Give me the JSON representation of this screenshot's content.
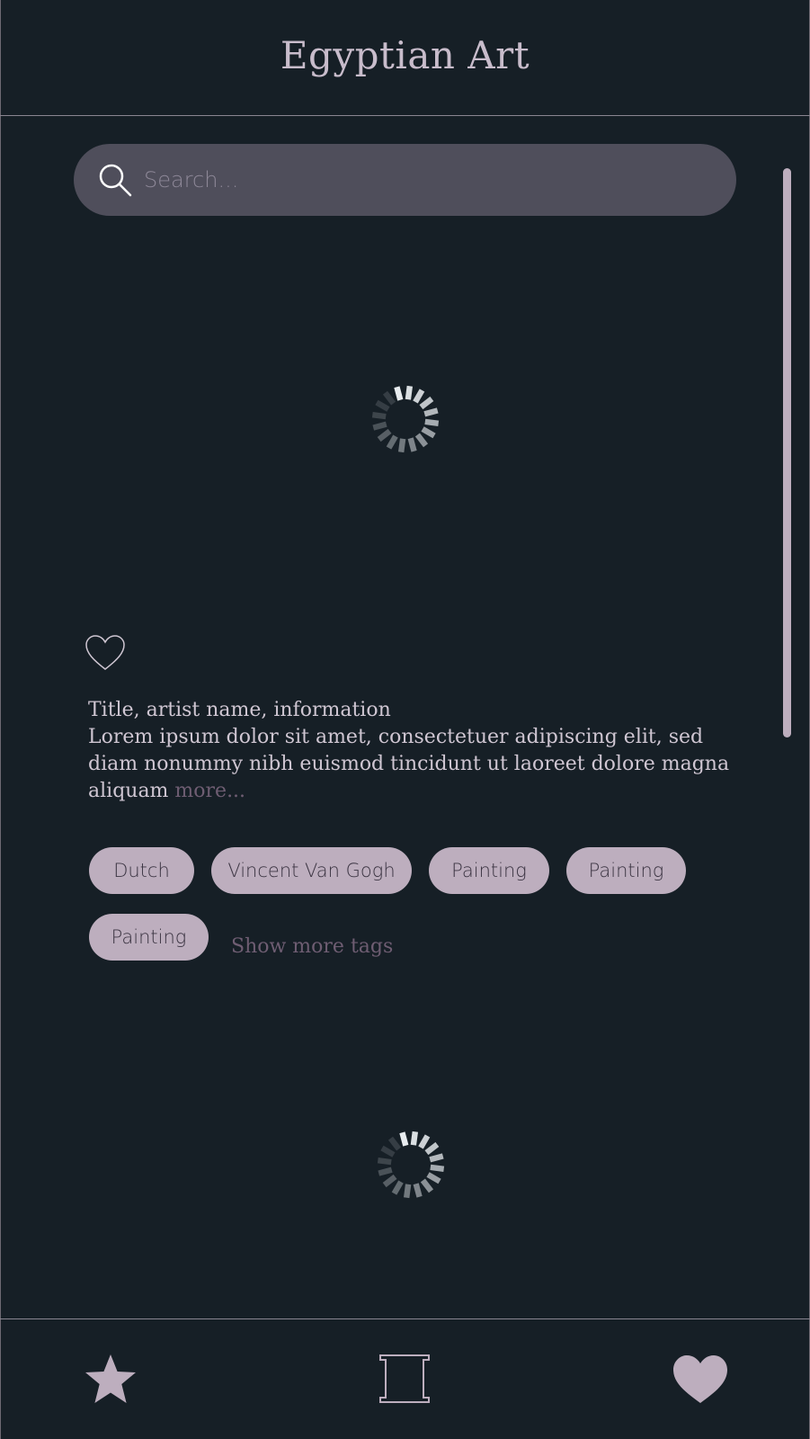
{
  "header": {
    "title": "Egyptian Art"
  },
  "search": {
    "placeholder": "Search..."
  },
  "artwork": {
    "caption_title": "Title, artist name, information",
    "caption_body": "Lorem ipsum dolor sit amet, consectetuer adipiscing elit, sed diam nonummy nibh euismod tincidunt ut laoreet dolore magna aliquam",
    "more_link": "more...",
    "tags": [
      "Dutch",
      "Vincent Van Gogh",
      "Painting",
      "Painting",
      "Painting"
    ],
    "show_more_tags": "Show more tags"
  },
  "bottom_nav": {
    "items": [
      {
        "icon": "star-icon"
      },
      {
        "icon": "frame-icon"
      },
      {
        "icon": "heart-icon"
      }
    ]
  },
  "colors": {
    "background": "#161f26",
    "accent": "#bdaebe",
    "search_bg": "#4f4e5b",
    "muted_link": "#6e5d72"
  }
}
